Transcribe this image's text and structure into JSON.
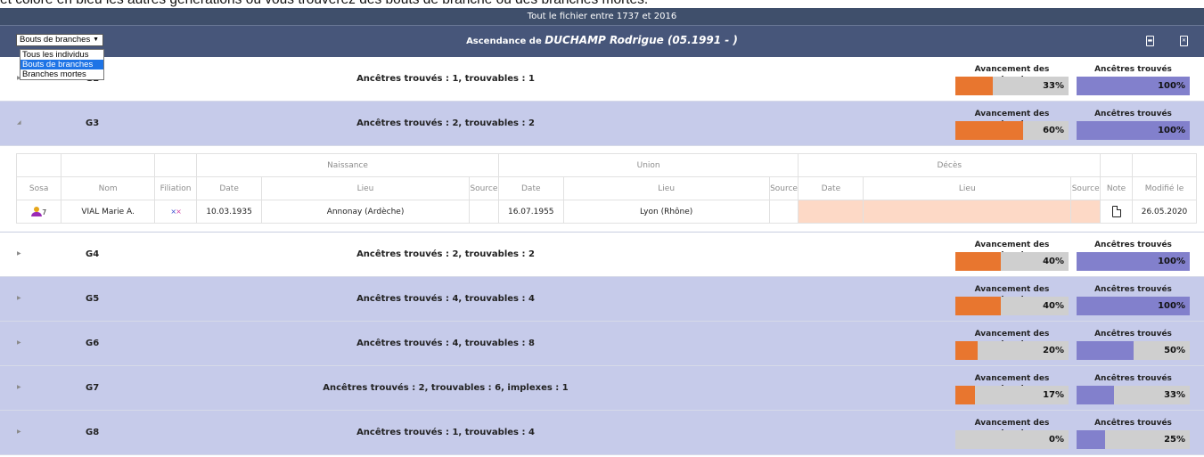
{
  "intro_text": "et colore en bleu les autres générations où vous trouverez des bouts de branche ou des branches mortes.",
  "topbar": {
    "text": "Tout le fichier entre 1737 et 2016"
  },
  "header": {
    "title_prefix": "Ascendance de",
    "title_name": "DUCHAMP Rodrigue (05.1991 - )",
    "pdf_icon": "pdf-file-icon",
    "excel_icon": "excel-file-icon"
  },
  "filter": {
    "selected": "Bouts de branches",
    "options": [
      "Tous les individus",
      "Bouts de branches",
      "Branches mortes"
    ],
    "highlighted_index": 1
  },
  "metric_labels": {
    "progress": "Avancement des recherches",
    "found": "Ancêtres trouvés"
  },
  "colors": {
    "header": "#47567a",
    "topbar": "#3f4f6b",
    "row_blue": "#c6cbea",
    "progress": "#e8762f",
    "found": "#8280cc",
    "death_missing": "#fdd9c6"
  },
  "generations": [
    {
      "gen": "G2",
      "summary": "Ancêtres trouvés : 1, trouvables : 1",
      "progress_pct": 33,
      "progress_label": "33%",
      "found_pct": 100,
      "found_label": "100%",
      "row_style": "white",
      "expanded": false
    },
    {
      "gen": "G3",
      "summary": "Ancêtres trouvés : 2, trouvables : 2",
      "progress_pct": 60,
      "progress_label": "60%",
      "found_pct": 100,
      "found_label": "100%",
      "row_style": "blue",
      "expanded": true
    },
    {
      "gen": "G4",
      "summary": "Ancêtres trouvés : 2, trouvables : 2",
      "progress_pct": 40,
      "progress_label": "40%",
      "found_pct": 100,
      "found_label": "100%",
      "row_style": "white",
      "expanded": false
    },
    {
      "gen": "G5",
      "summary": "Ancêtres trouvés : 4, trouvables : 4",
      "progress_pct": 40,
      "progress_label": "40%",
      "found_pct": 100,
      "found_label": "100%",
      "row_style": "blue",
      "expanded": false
    },
    {
      "gen": "G6",
      "summary": "Ancêtres trouvés : 4, trouvables : 8",
      "progress_pct": 20,
      "progress_label": "20%",
      "found_pct": 50,
      "found_label": "50%",
      "row_style": "blue",
      "expanded": false
    },
    {
      "gen": "G7",
      "summary": "Ancêtres trouvés : 2, trouvables : 6, implexes : 1",
      "progress_pct": 17,
      "progress_label": "17%",
      "found_pct": 33,
      "found_label": "33%",
      "row_style": "blue",
      "expanded": false
    },
    {
      "gen": "G8",
      "summary": "Ancêtres trouvés : 1, trouvables : 4",
      "progress_pct": 0,
      "progress_label": "0%",
      "found_pct": 25,
      "found_label": "25%",
      "row_style": "blue",
      "expanded": false
    }
  ],
  "table": {
    "groups": {
      "naissance": "Naissance",
      "union": "Union",
      "deces": "Décès"
    },
    "columns": {
      "sosa": "Sosa",
      "nom": "Nom",
      "filiation": "Filiation",
      "date": "Date",
      "lieu": "Lieu",
      "source": "Source",
      "note": "Note",
      "modifie": "Modifié le"
    },
    "row": {
      "sosa": "7",
      "nom": "VIAL Marie A.",
      "birth_date": "10.03.1935",
      "birth_place": "Annonay (Ardèche)",
      "birth_source": "",
      "union_date": "16.07.1955",
      "union_place": "Lyon (Rhône)",
      "union_source": "",
      "death_date": "",
      "death_place": "",
      "death_source": "",
      "modified": "26.05.2020"
    }
  }
}
